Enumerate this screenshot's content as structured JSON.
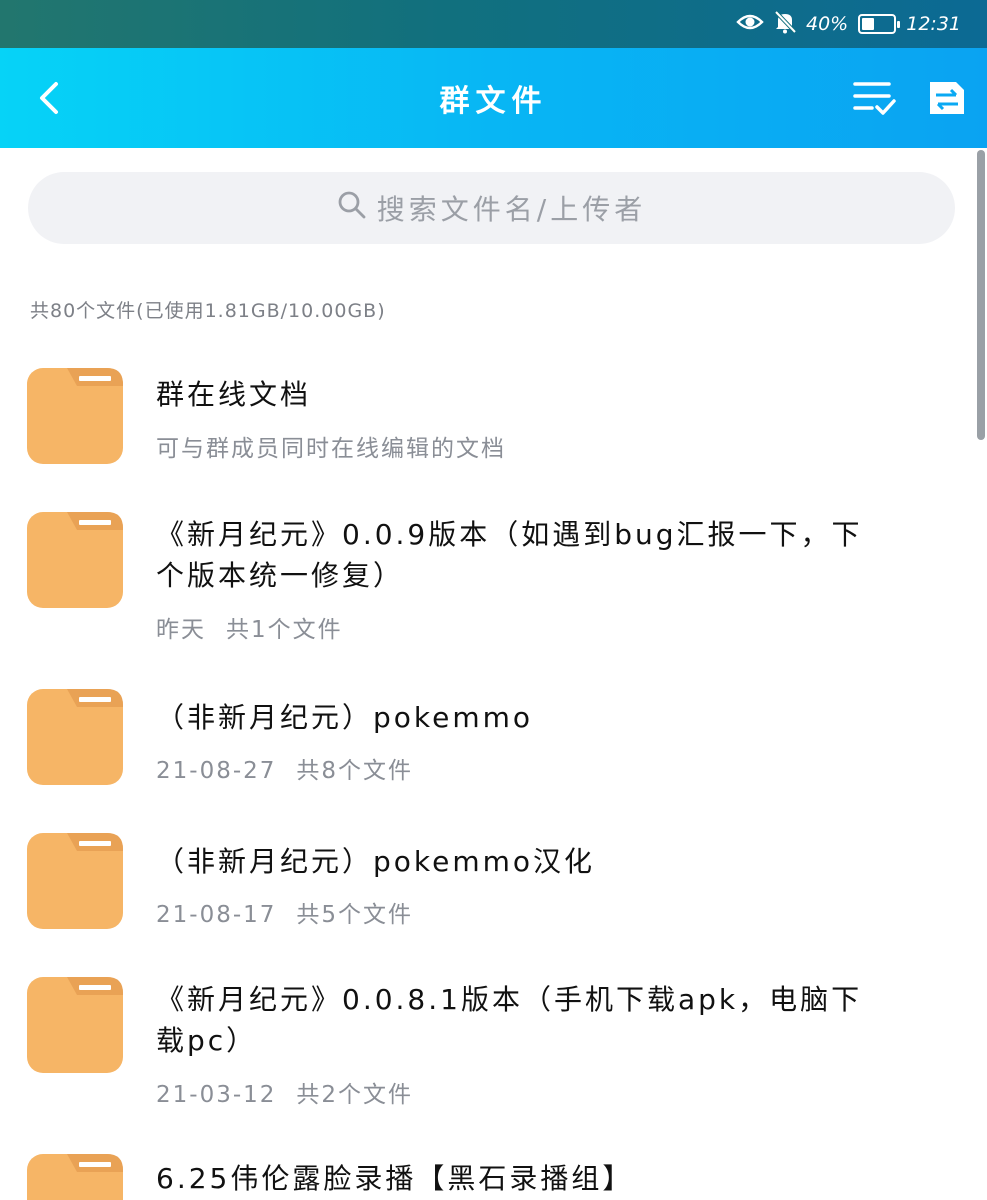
{
  "status_bar": {
    "battery_percent": "40%",
    "battery_level": 0.4,
    "time": "12:31"
  },
  "header": {
    "title": "群文件"
  },
  "search": {
    "placeholder": "搜索文件名/上传者"
  },
  "summary": "共80个文件(已使用1.81GB/10.00GB)",
  "colors": {
    "header_start": "#06d3f7",
    "header_end": "#0aa3f2",
    "folder": "#f6b566",
    "folder_tab": "#e9a255"
  },
  "items": [
    {
      "name": "群在线文档",
      "date": "可与群成员同时在线编辑的文档",
      "count": ""
    },
    {
      "name": "《新月纪元》0.0.9版本（如遇到bug汇报一下，下个版本统一修复）",
      "date": "昨天",
      "count": "共1个文件"
    },
    {
      "name": "（非新月纪元）pokemmo",
      "date": "21-08-27",
      "count": "共8个文件"
    },
    {
      "name": "（非新月纪元）pokemmo汉化",
      "date": "21-08-17",
      "count": "共5个文件"
    },
    {
      "name": "《新月纪元》0.0.8.1版本（手机下载apk，电脑下载pc）",
      "date": "21-03-12",
      "count": "共2个文件"
    },
    {
      "name": "6.25伟伦露脸录播【黑石录播组】",
      "date": "",
      "count": ""
    }
  ]
}
